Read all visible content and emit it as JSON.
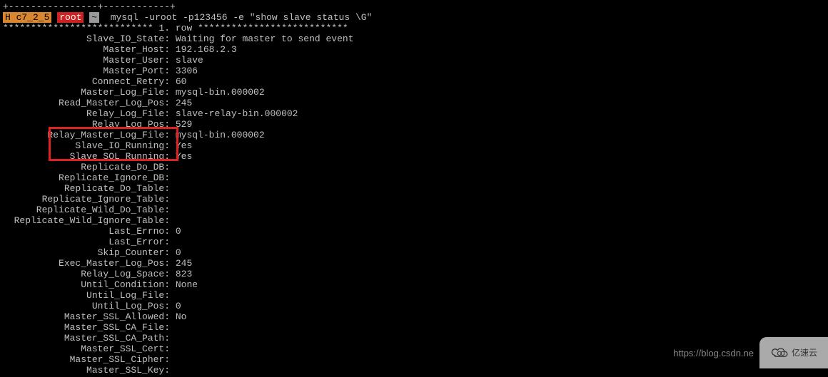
{
  "prompt": {
    "border_top": "+----------------+------------+",
    "host_badge": "H c7_2_5",
    "root_badge": "root",
    "tilde": "~",
    "command": "mysql -uroot -p123456 -e \"show slave status \\G\""
  },
  "row_header": "*************************** 1. row ***************************",
  "fields": [
    {
      "label": "Slave_IO_State",
      "value": "Waiting for master to send event"
    },
    {
      "label": "Master_Host",
      "value": "192.168.2.3"
    },
    {
      "label": "Master_User",
      "value": "slave"
    },
    {
      "label": "Master_Port",
      "value": "3306"
    },
    {
      "label": "Connect_Retry",
      "value": "60"
    },
    {
      "label": "Master_Log_File",
      "value": "mysql-bin.000002"
    },
    {
      "label": "Read_Master_Log_Pos",
      "value": "245"
    },
    {
      "label": "Relay_Log_File",
      "value": "slave-relay-bin.000002"
    },
    {
      "label": "Relay_Log_Pos",
      "value": "529"
    },
    {
      "label": "Relay_Master_Log_File",
      "value": "mysql-bin.000002"
    },
    {
      "label": "Slave_IO_Running",
      "value": "Yes"
    },
    {
      "label": "Slave_SQL_Running",
      "value": "Yes"
    },
    {
      "label": "Replicate_Do_DB",
      "value": ""
    },
    {
      "label": "Replicate_Ignore_DB",
      "value": ""
    },
    {
      "label": "Replicate_Do_Table",
      "value": ""
    },
    {
      "label": "Replicate_Ignore_Table",
      "value": ""
    },
    {
      "label": "Replicate_Wild_Do_Table",
      "value": ""
    },
    {
      "label": "Replicate_Wild_Ignore_Table",
      "value": ""
    },
    {
      "label": "Last_Errno",
      "value": "0"
    },
    {
      "label": "Last_Error",
      "value": ""
    },
    {
      "label": "Skip_Counter",
      "value": "0"
    },
    {
      "label": "Exec_Master_Log_Pos",
      "value": "245"
    },
    {
      "label": "Relay_Log_Space",
      "value": "823"
    },
    {
      "label": "Until_Condition",
      "value": "None"
    },
    {
      "label": "Until_Log_File",
      "value": ""
    },
    {
      "label": "Until_Log_Pos",
      "value": "0"
    },
    {
      "label": "Master_SSL_Allowed",
      "value": "No"
    },
    {
      "label": "Master_SSL_CA_File",
      "value": ""
    },
    {
      "label": "Master_SSL_CA_Path",
      "value": ""
    },
    {
      "label": "Master_SSL_Cert",
      "value": ""
    },
    {
      "label": "Master_SSL_Cipher",
      "value": ""
    },
    {
      "label": "Master_SSL_Key",
      "value": ""
    }
  ],
  "label_width": 29,
  "watermark": "https://blog.csdn.ne",
  "logo_text": "亿速云"
}
